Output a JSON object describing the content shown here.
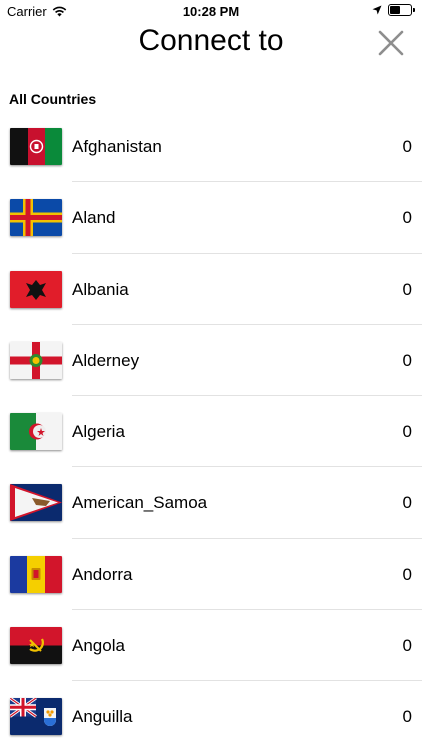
{
  "status_bar": {
    "carrier": "Carrier",
    "time": "10:28 PM"
  },
  "header": {
    "title": "Connect to"
  },
  "section": {
    "title": "All Countries"
  },
  "countries": [
    {
      "name": "Afghanistan",
      "count": "0",
      "flag": "afghanistan-flag"
    },
    {
      "name": "Aland",
      "count": "0",
      "flag": "aland-flag"
    },
    {
      "name": "Albania",
      "count": "0",
      "flag": "albania-flag"
    },
    {
      "name": "Alderney",
      "count": "0",
      "flag": "alderney-flag"
    },
    {
      "name": "Algeria",
      "count": "0",
      "flag": "algeria-flag"
    },
    {
      "name": "American_Samoa",
      "count": "0",
      "flag": "american-samoa-flag"
    },
    {
      "name": "Andorra",
      "count": "0",
      "flag": "andorra-flag"
    },
    {
      "name": "Angola",
      "count": "0",
      "flag": "angola-flag"
    },
    {
      "name": "Anguilla",
      "count": "0",
      "flag": "anguilla-flag"
    }
  ],
  "colors": {
    "separator": "#e2e2e2",
    "close_icon": "#8e8e8e"
  }
}
